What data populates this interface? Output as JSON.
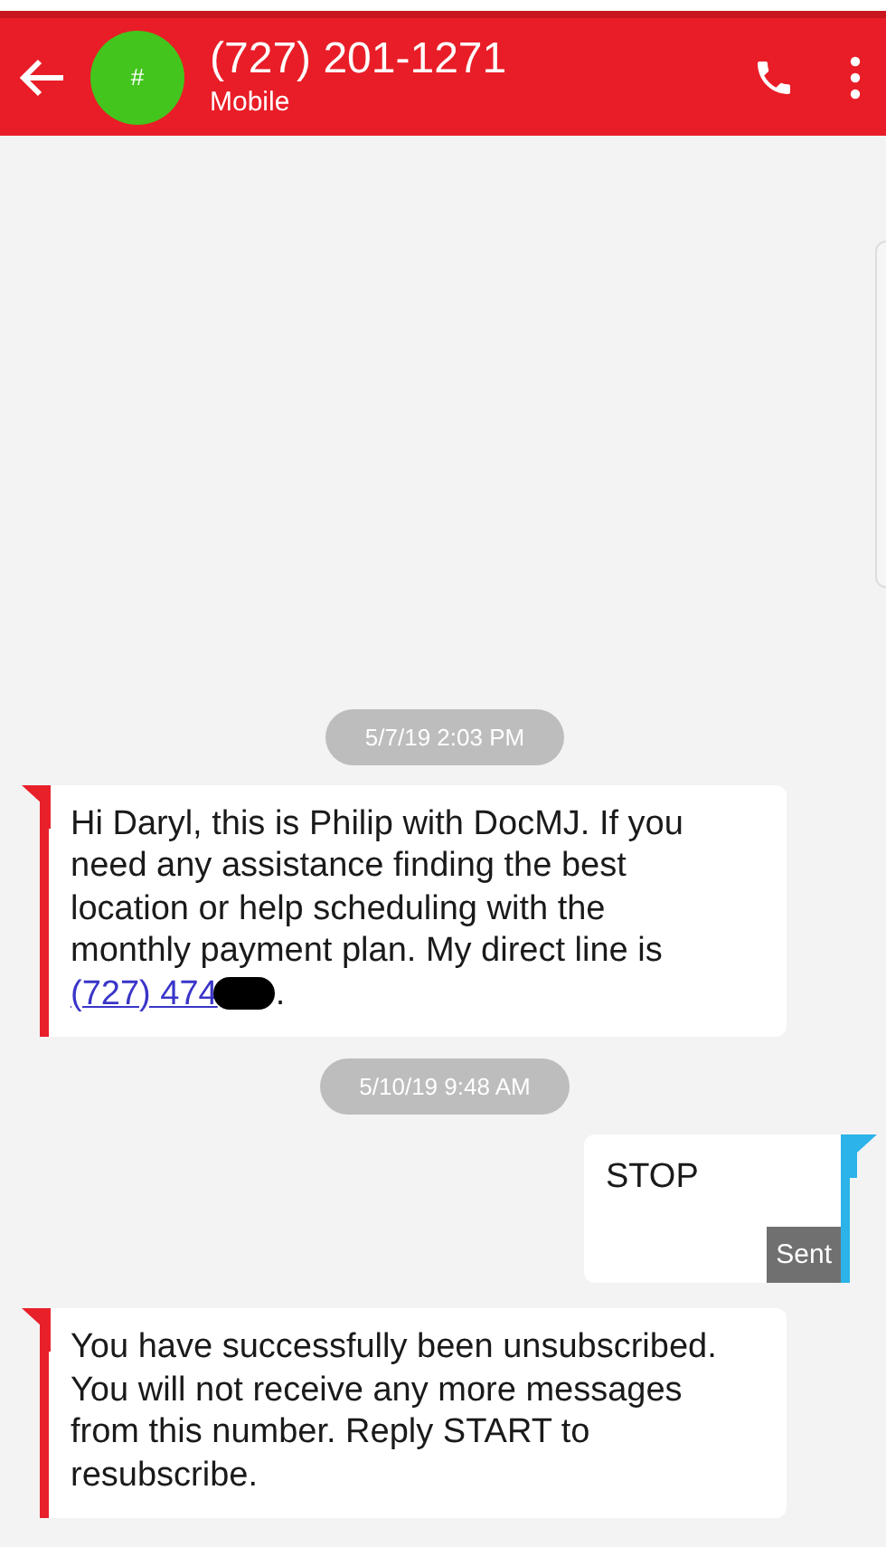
{
  "header": {
    "avatar_text": "#",
    "title": "(727) 201-1271",
    "subtitle": "Mobile"
  },
  "messages": [
    {
      "kind": "timestamp",
      "text": "5/7/19 2:03 PM"
    },
    {
      "kind": "incoming",
      "text": "Hi Daryl, this is Philip with DocMJ. If you need any assistance finding the best location or help scheduling with the monthly payment plan. My direct line is ",
      "link": "(727) 474",
      "redacted": true,
      "after": "."
    },
    {
      "kind": "timestamp",
      "text": "5/10/19 9:48 AM"
    },
    {
      "kind": "outgoing",
      "text": "STOP",
      "status": "Sent"
    },
    {
      "kind": "incoming",
      "text": "You have successfully been unsubscribed. You will not receive any more messages from this number. Reply START to resubscribe."
    }
  ]
}
